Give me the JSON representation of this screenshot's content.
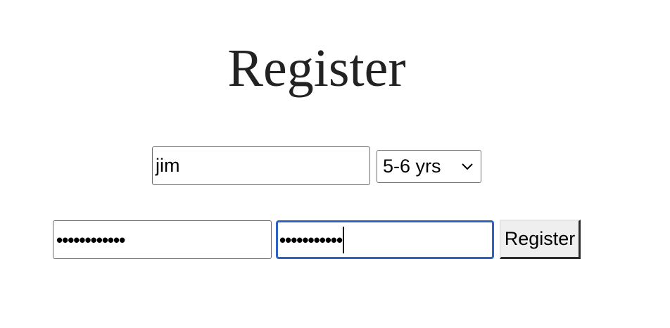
{
  "page": {
    "title": "Register"
  },
  "form": {
    "username": {
      "value": "jim"
    },
    "experience": {
      "selected": "5-6 yrs"
    },
    "password": {
      "masked_value": "••••••••••••"
    },
    "confirm_password": {
      "masked_value": "•••••••••••"
    },
    "submit_label": "Register"
  },
  "icons": {
    "select_arrow": "chevron-down-icon"
  },
  "colors": {
    "focus_border": "#2f63c2",
    "title_text": "#222222",
    "button_bg": "#efefef"
  }
}
